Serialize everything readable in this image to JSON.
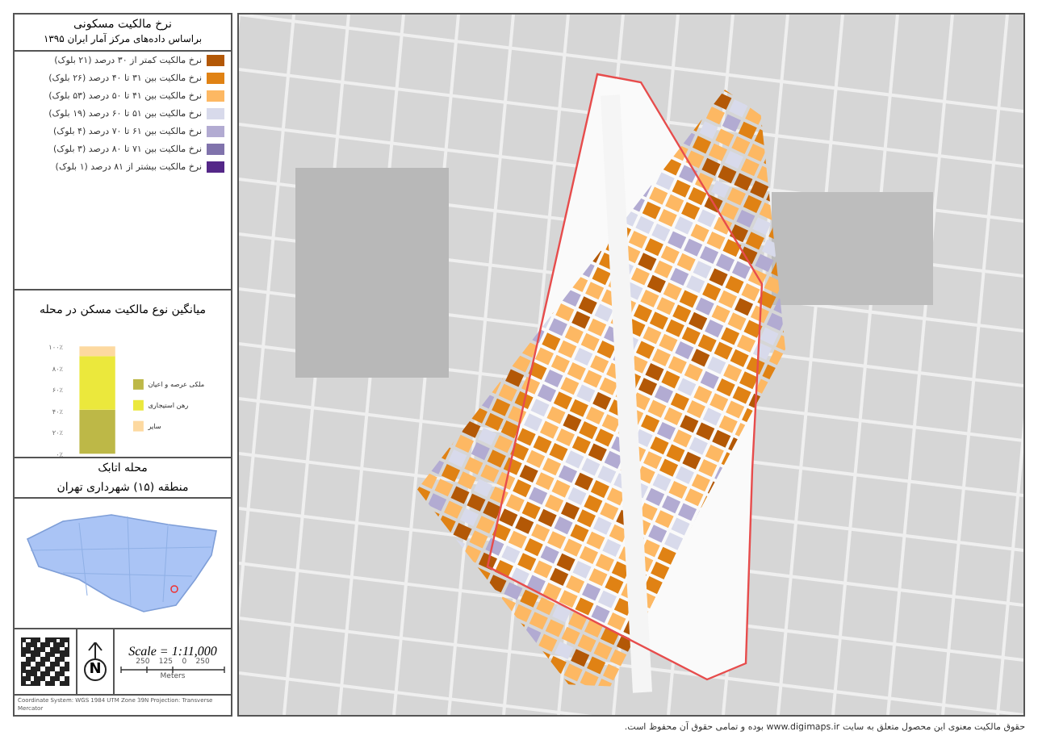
{
  "legend": {
    "title": "نرخ مالکیت مسکونی",
    "subtitle": "براساس داده‌های مرکز آمار ایران ۱۳۹۵",
    "items": [
      {
        "label": "نرخ مالکیت کمتر از ۳۰ درصد (۲۱ بلوک)",
        "color": "#b35806"
      },
      {
        "label": "نرخ مالکیت بین ۳۱ تا ۴۰ درصد (۲۶ بلوک)",
        "color": "#e08214"
      },
      {
        "label": "نرخ مالکیت بین ۴۱ تا ۵۰ درصد (۵۳ بلوک)",
        "color": "#fdb863"
      },
      {
        "label": "نرخ مالکیت بین ۵۱ تا ۶۰ درصد (۱۹ بلوک)",
        "color": "#d8daeb"
      },
      {
        "label": "نرخ مالکیت بین ۶۱ تا ۷۰ درصد (۴ بلوک)",
        "color": "#b2abd2"
      },
      {
        "label": "نرخ مالکیت بین ۷۱ تا ۸۰ درصد (۳ بلوک)",
        "color": "#8073ac"
      },
      {
        "label": "نرخ مالکیت بیشتر از ۸۱ درصد (۱ بلوک)",
        "color": "#542788"
      }
    ]
  },
  "chart": {
    "chart_data": {
      "type": "bar",
      "legend": true,
      "title": "میانگین نوع مالکیت مسکن در محله",
      "stacked": true,
      "ylim": [
        0,
        100
      ],
      "yticks": [
        {
          "value": 0,
          "label": "۰٪"
        },
        {
          "value": 20,
          "label": "۲۰٪"
        },
        {
          "value": 40,
          "label": "۴۰٪"
        },
        {
          "value": 60,
          "label": "۶۰٪"
        },
        {
          "value": 80,
          "label": "۸۰٪"
        },
        {
          "value": 100,
          "label": "۱۰۰٪"
        }
      ],
      "series": [
        {
          "name": "ملکی عرصه و اعیان",
          "color": "#bdb847",
          "values": [
            41
          ]
        },
        {
          "name": "رهن استیجاری",
          "color": "#ebe83c",
          "values": [
            50
          ]
        },
        {
          "name": "سایر",
          "color": "#fdd9a0",
          "values": [
            9
          ]
        }
      ]
    }
  },
  "location": {
    "neighborhood": "محله اتابک",
    "district": "منطقه (۱۵) شهرداری تهران"
  },
  "scale": {
    "text": "Scale = 1:11,000",
    "tick_labels": "250    125    0    250",
    "unit": "Meters",
    "north": "N"
  },
  "credits": "Coordinate System: WGS 1984 UTM Zone 39N  Projection: Transverse Mercator",
  "copyright": "حقوق مالکیت معنوی این محصول متعلق به سایت www.digimaps.ir بوده و تمامی حقوق آن محفوظ است."
}
